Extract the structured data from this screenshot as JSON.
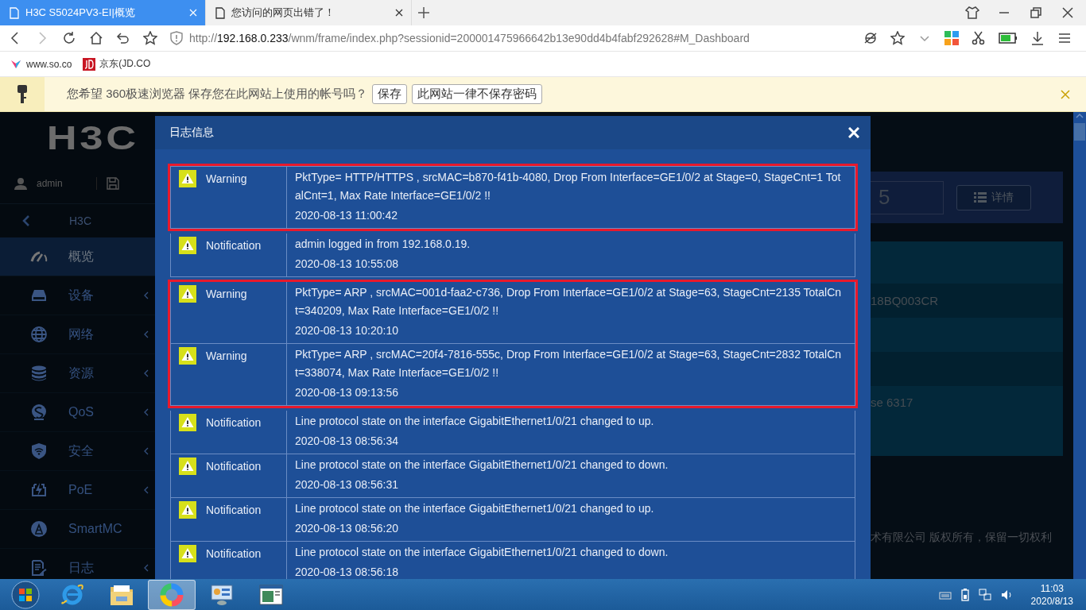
{
  "browser": {
    "tabs": [
      {
        "title": "H3C S5024PV3-EI|概览",
        "selected": true
      },
      {
        "title": "您访问的网页出错了！",
        "selected": false
      }
    ],
    "url": {
      "scheme": "http://",
      "host": "192.168.0.233",
      "path": "/wnm/frame/index.php?sessionid=200001475966642b13e90dd4b4fabf292628#M_Dashboard"
    },
    "bookmarks": [
      {
        "label": "www.so.co",
        "kind": "so"
      },
      {
        "label": "京东(JD.CO",
        "kind": "jd"
      }
    ],
    "password_bar": {
      "message": "您希望 360极速浏览器 保存您在此网站上使用的帐号吗？",
      "buttons": [
        "保存",
        "此网站一律不保存密码"
      ]
    }
  },
  "sidebar": {
    "logo": "H3C",
    "user": "admin",
    "breadcrumb": "H3C",
    "items": [
      {
        "label": "概览",
        "kind": "gauge",
        "selected": true,
        "has_submenu": false
      },
      {
        "label": "设备",
        "kind": "drive",
        "selected": false,
        "has_submenu": true
      },
      {
        "label": "网络",
        "kind": "globe",
        "selected": false,
        "has_submenu": true
      },
      {
        "label": "资源",
        "kind": "db",
        "selected": false,
        "has_submenu": true
      },
      {
        "label": "QoS",
        "kind": "qos",
        "selected": false,
        "has_submenu": true
      },
      {
        "label": "安全",
        "kind": "shield",
        "selected": false,
        "has_submenu": true
      },
      {
        "label": "PoE",
        "kind": "poe",
        "selected": false,
        "has_submenu": true
      },
      {
        "label": "SmartMC",
        "kind": "smart",
        "selected": false,
        "has_submenu": false
      },
      {
        "label": "日志",
        "kind": "log",
        "selected": false,
        "has_submenu": true
      }
    ]
  },
  "dashboard": {
    "count": "5",
    "details_button": "详情",
    "rows": [
      "",
      "18BQ003CR",
      "",
      "",
      "se 6317"
    ],
    "copyright": "术有限公司 版权所有，保留一切权利"
  },
  "dialog": {
    "title": "日志信息",
    "groups": [
      {
        "highlighted": true,
        "entries": [
          {
            "level": "Warning",
            "message": "PktType= HTTP/HTTPS , srcMAC=b870-f41b-4080, Drop From Interface=GE1/0/2 at Stage=0, StageCnt=1 TotalCnt=1, Max Rate Interface=GE1/0/2 !!",
            "time": "2020-08-13 11:00:42"
          }
        ]
      },
      {
        "highlighted": false,
        "entries": [
          {
            "level": "Notification",
            "message": "admin logged in from 192.168.0.19.",
            "time": "2020-08-13 10:55:08"
          }
        ]
      },
      {
        "highlighted": true,
        "entries": [
          {
            "level": "Warning",
            "message": "PktType= ARP , srcMAC=001d-faa2-c736, Drop From Interface=GE1/0/2 at Stage=63, StageCnt=2135 TotalCnt=340209, Max Rate Interface=GE1/0/2 !!",
            "time": "2020-08-13 10:20:10"
          },
          {
            "level": "Warning",
            "message": "PktType= ARP , srcMAC=20f4-7816-555c, Drop From Interface=GE1/0/2 at Stage=63, StageCnt=2832 TotalCnt=338074, Max Rate Interface=GE1/0/2 !!",
            "time": "2020-08-13 09:13:56"
          }
        ]
      },
      {
        "highlighted": false,
        "entries": [
          {
            "level": "Notification",
            "message": "Line protocol state on the interface GigabitEthernet1/0/21 changed to up.",
            "time": "2020-08-13 08:56:34"
          },
          {
            "level": "Notification",
            "message": "Line protocol state on the interface GigabitEthernet1/0/21 changed to down.",
            "time": "2020-08-13 08:56:31"
          },
          {
            "level": "Notification",
            "message": "Line protocol state on the interface GigabitEthernet1/0/21 changed to up.",
            "time": "2020-08-13 08:56:20"
          },
          {
            "level": "Notification",
            "message": "Line protocol state on the interface GigabitEthernet1/0/21 changed to down.",
            "time": "2020-08-13 08:56:18"
          }
        ]
      }
    ]
  },
  "taskbar": {
    "apps": [
      {
        "kind": "ie",
        "active": false
      },
      {
        "kind": "folder",
        "active": false
      },
      {
        "kind": "browser360",
        "active": true
      },
      {
        "kind": "panel",
        "active": false
      },
      {
        "kind": "window",
        "active": false
      }
    ],
    "time": "11:03",
    "date": "2020/8/13"
  }
}
